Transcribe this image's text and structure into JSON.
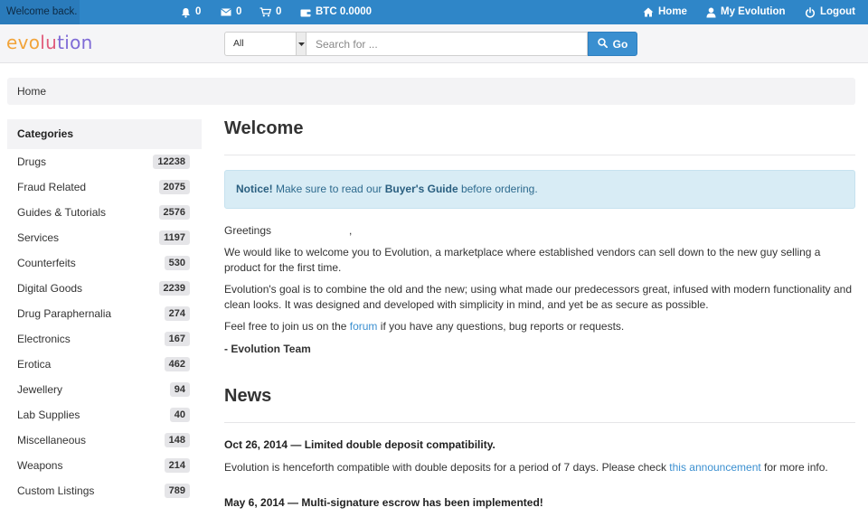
{
  "topbar": {
    "welcome": "Welcome back.",
    "notifications": "0",
    "messages": "0",
    "cart": "0",
    "balance": "BTC 0.0000",
    "home": "Home",
    "my_account": "My Evolution",
    "logout": "Logout"
  },
  "header": {
    "logo": {
      "part1": "evo",
      "part2": "lu",
      "part3": "tion"
    },
    "search": {
      "category_selected": "All",
      "placeholder": "Search for ...",
      "go_label": "Go"
    }
  },
  "breadcrumb": "Home",
  "sidebar": {
    "title": "Categories",
    "items": [
      {
        "label": "Drugs",
        "count": "12238"
      },
      {
        "label": "Fraud Related",
        "count": "2075"
      },
      {
        "label": "Guides & Tutorials",
        "count": "2576"
      },
      {
        "label": "Services",
        "count": "1197"
      },
      {
        "label": "Counterfeits",
        "count": "530"
      },
      {
        "label": "Digital Goods",
        "count": "2239"
      },
      {
        "label": "Drug Paraphernalia",
        "count": "274"
      },
      {
        "label": "Electronics",
        "count": "167"
      },
      {
        "label": "Erotica",
        "count": "462"
      },
      {
        "label": "Jewellery",
        "count": "94"
      },
      {
        "label": "Lab Supplies",
        "count": "40"
      },
      {
        "label": "Miscellaneous",
        "count": "148"
      },
      {
        "label": "Weapons",
        "count": "214"
      },
      {
        "label": "Custom Listings",
        "count": "789"
      }
    ]
  },
  "main": {
    "welcome_heading": "Welcome",
    "notice": {
      "lead": "Notice!",
      "text_before": " Make sure to read our ",
      "guide": "Buyer's Guide",
      "text_after": " before ordering."
    },
    "greeting": "Greetings",
    "greeting_comma": ",",
    "intro": "We would like to welcome you to Evolution, a marketplace where established vendors can sell down to the new guy selling a product for the first time.",
    "goal": "Evolution's goal is to combine the old and the new; using what made our predecessors great, infused with modern functionality and clean looks. It was designed and developed with simplicity in mind, and yet be as secure as possible.",
    "forum": {
      "before": "Feel free to join us on the ",
      "link": "forum",
      "after": " if you have any questions, bug reports or requests."
    },
    "signature": "- Evolution Team",
    "news_heading": "News",
    "news": [
      {
        "title": "Oct 26, 2014 — Limited double deposit compatibility.",
        "body_before": "Evolution is henceforth compatible with double deposits for a period of 7 days. Please check ",
        "link": "this announcement",
        "body_after": " for more info."
      },
      {
        "title": "May 6, 2014 — Multi-signature escrow has been implemented!"
      }
    ]
  },
  "colors": {
    "topbar": "#2f86c8",
    "accent": "#3a8fd0",
    "notice_bg": "#d8ecf5",
    "logo_orange": "#f2a43a",
    "logo_pink": "#e05b7b",
    "logo_purple": "#7e6ad6"
  },
  "icons": [
    "bell-icon",
    "envelope-icon",
    "cart-icon",
    "wallet-icon",
    "home-icon",
    "user-icon",
    "power-icon",
    "search-icon",
    "caret-down-icon"
  ]
}
